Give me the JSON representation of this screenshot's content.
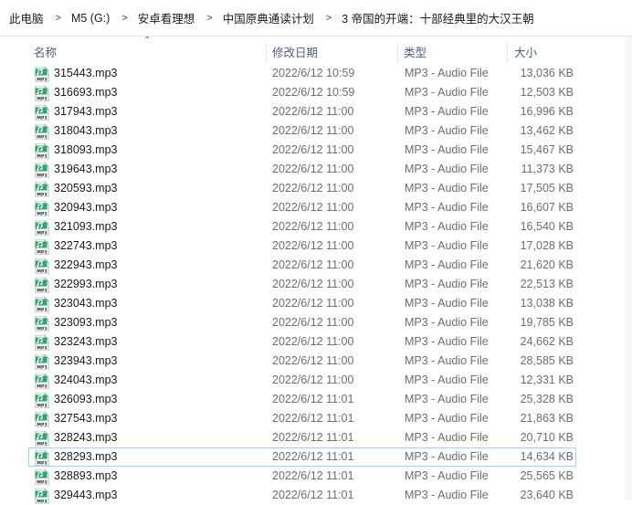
{
  "breadcrumb": [
    "此电脑",
    "M5 (G:)",
    "安卓看理想",
    "中国原典通读计划",
    "3 帝国的开端：十部经典里的大汉王朝"
  ],
  "columns": {
    "name": "名称",
    "date": "修改日期",
    "type": "类型",
    "size": "大小"
  },
  "icon": {
    "name": "mp3-file-icon",
    "label": "MP3",
    "color": "#2ea76a"
  },
  "files": [
    {
      "name": "315443.mp3",
      "date": "2022/6/12 10:59",
      "type": "MP3 - Audio File",
      "size": "13,036 KB"
    },
    {
      "name": "316693.mp3",
      "date": "2022/6/12 10:59",
      "type": "MP3 - Audio File",
      "size": "12,503 KB"
    },
    {
      "name": "317943.mp3",
      "date": "2022/6/12 11:00",
      "type": "MP3 - Audio File",
      "size": "16,996 KB"
    },
    {
      "name": "318043.mp3",
      "date": "2022/6/12 11:00",
      "type": "MP3 - Audio File",
      "size": "13,462 KB"
    },
    {
      "name": "318093.mp3",
      "date": "2022/6/12 11:00",
      "type": "MP3 - Audio File",
      "size": "15,467 KB"
    },
    {
      "name": "319643.mp3",
      "date": "2022/6/12 11:00",
      "type": "MP3 - Audio File",
      "size": "11,373 KB"
    },
    {
      "name": "320593.mp3",
      "date": "2022/6/12 11:00",
      "type": "MP3 - Audio File",
      "size": "17,505 KB"
    },
    {
      "name": "320943.mp3",
      "date": "2022/6/12 11:00",
      "type": "MP3 - Audio File",
      "size": "16,607 KB"
    },
    {
      "name": "321093.mp3",
      "date": "2022/6/12 11:00",
      "type": "MP3 - Audio File",
      "size": "16,540 KB"
    },
    {
      "name": "322743.mp3",
      "date": "2022/6/12 11:00",
      "type": "MP3 - Audio File",
      "size": "17,028 KB"
    },
    {
      "name": "322943.mp3",
      "date": "2022/6/12 11:00",
      "type": "MP3 - Audio File",
      "size": "21,620 KB"
    },
    {
      "name": "322993.mp3",
      "date": "2022/6/12 11:00",
      "type": "MP3 - Audio File",
      "size": "22,513 KB"
    },
    {
      "name": "323043.mp3",
      "date": "2022/6/12 11:00",
      "type": "MP3 - Audio File",
      "size": "13,038 KB"
    },
    {
      "name": "323093.mp3",
      "date": "2022/6/12 11:00",
      "type": "MP3 - Audio File",
      "size": "19,785 KB"
    },
    {
      "name": "323243.mp3",
      "date": "2022/6/12 11:00",
      "type": "MP3 - Audio File",
      "size": "24,662 KB"
    },
    {
      "name": "323943.mp3",
      "date": "2022/6/12 11:00",
      "type": "MP3 - Audio File",
      "size": "28,585 KB"
    },
    {
      "name": "324043.mp3",
      "date": "2022/6/12 11:00",
      "type": "MP3 - Audio File",
      "size": "12,331 KB"
    },
    {
      "name": "326093.mp3",
      "date": "2022/6/12 11:01",
      "type": "MP3 - Audio File",
      "size": "25,328 KB"
    },
    {
      "name": "327543.mp3",
      "date": "2022/6/12 11:01",
      "type": "MP3 - Audio File",
      "size": "21,863 KB"
    },
    {
      "name": "328243.mp3",
      "date": "2022/6/12 11:01",
      "type": "MP3 - Audio File",
      "size": "20,710 KB"
    },
    {
      "name": "328293.mp3",
      "date": "2022/6/12 11:01",
      "type": "MP3 - Audio File",
      "size": "14,634 KB",
      "focused": true
    },
    {
      "name": "328893.mp3",
      "date": "2022/6/12 11:01",
      "type": "MP3 - Audio File",
      "size": "25,565 KB"
    },
    {
      "name": "329443.mp3",
      "date": "2022/6/12 11:01",
      "type": "MP3 - Audio File",
      "size": "23,640 KB"
    }
  ]
}
